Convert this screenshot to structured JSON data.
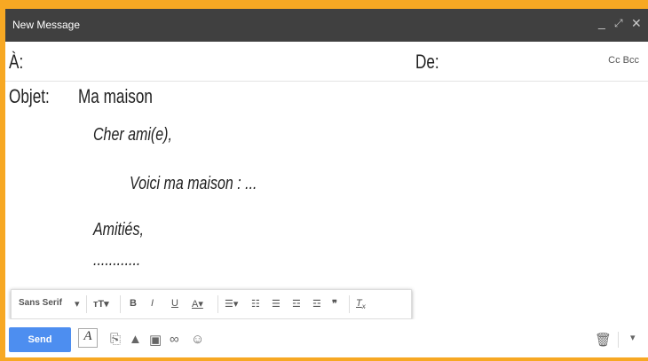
{
  "window": {
    "title": "New Message"
  },
  "header": {
    "to_label": "À:",
    "from_label": "De:",
    "cc_bcc": "Cc Bcc",
    "subject_label": "Objet:",
    "subject_value": "Ma maison"
  },
  "body": {
    "greeting": "Cher ami(e),",
    "line": "Voici ma maison : ...",
    "closing": "Amitiés,",
    "signature": "............"
  },
  "format": {
    "font": "Sans Serif"
  },
  "actions": {
    "send_label": "Send"
  }
}
